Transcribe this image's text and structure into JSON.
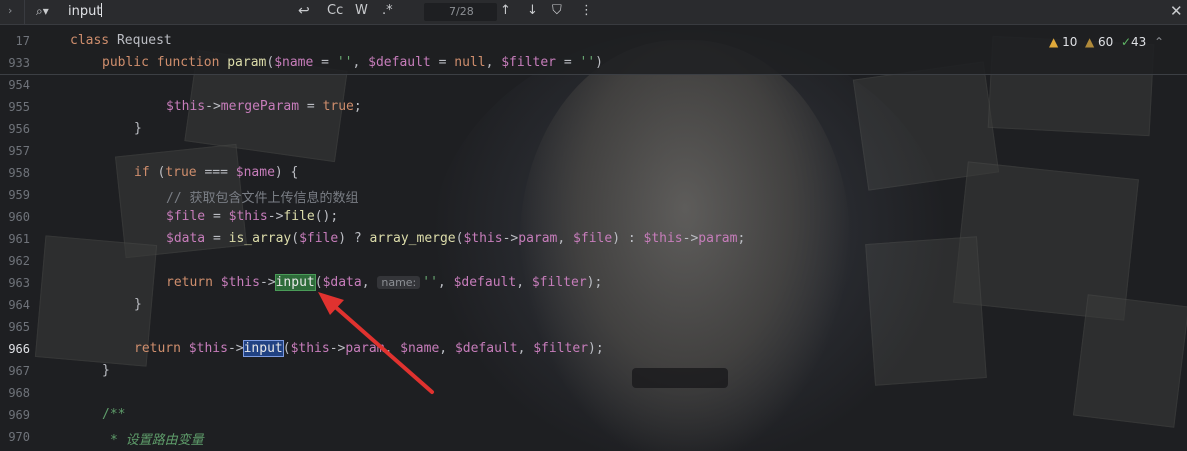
{
  "find": {
    "query": "input",
    "match_counter": "7/28",
    "buttons": {
      "case": "Cc",
      "words": "W",
      "regex": ".*"
    }
  },
  "sticky": {
    "class_line_no": "17",
    "class_line": "class Request",
    "method_line_no": "933"
  },
  "inspections": {
    "warnings": "10",
    "weak_warnings": "60",
    "typos": "43"
  },
  "lines": [
    {
      "no": "954",
      "text": ""
    },
    {
      "no": "955",
      "text": "$this->mergeParam = true;"
    },
    {
      "no": "956",
      "text": "}"
    },
    {
      "no": "957",
      "text": ""
    },
    {
      "no": "958",
      "text": "if (true === $name) {"
    },
    {
      "no": "959",
      "text": "// 获取包含文件上传信息的数组"
    },
    {
      "no": "960",
      "text": "$file = $this->file();"
    },
    {
      "no": "961",
      "text": "$data = is_array($file) ? array_merge($this->param, $file) : $this->param;"
    },
    {
      "no": "962",
      "text": ""
    },
    {
      "no": "963",
      "text": "return $this->input($data, name: '', $default, $filter);"
    },
    {
      "no": "964",
      "text": "}"
    },
    {
      "no": "965",
      "text": ""
    },
    {
      "no": "966",
      "text": "return $this->input($this->param, $name, $default, $filter);"
    },
    {
      "no": "967",
      "text": "}"
    },
    {
      "no": "968",
      "text": ""
    },
    {
      "no": "969",
      "text": "/**"
    },
    {
      "no": "970",
      "text": "* 设置路由变量"
    }
  ],
  "param_hint": "name:",
  "annotation_color": "#e0322f"
}
